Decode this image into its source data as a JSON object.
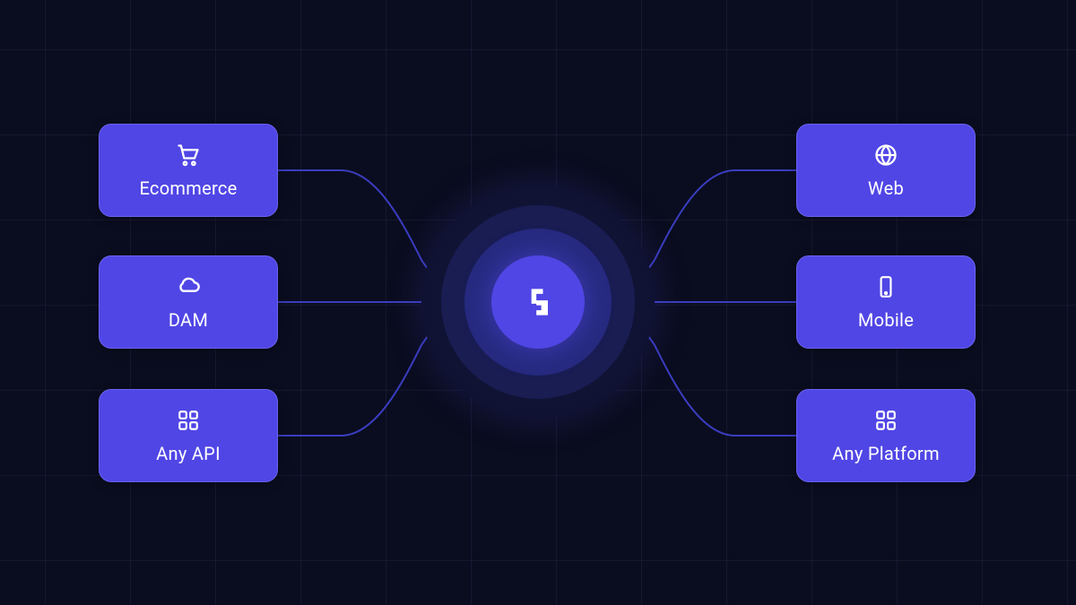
{
  "colors": {
    "background": "#0a0d1f",
    "grid_line": "rgba(80,80,150,0.15)",
    "node_fill": "#5046e5",
    "node_border": "#6a63f0",
    "connector": "#3a3dbf",
    "text": "#ffffff"
  },
  "left_nodes": [
    {
      "label": "Ecommerce",
      "icon": "cart-icon"
    },
    {
      "label": "DAM",
      "icon": "cloud-icon"
    },
    {
      "label": "Any API",
      "icon": "grid-icon"
    }
  ],
  "right_nodes": [
    {
      "label": "Web",
      "icon": "globe-icon"
    },
    {
      "label": "Mobile",
      "icon": "mobile-icon"
    },
    {
      "label": "Any Platform",
      "icon": "grid-icon"
    }
  ],
  "center": {
    "name": "hub-logo"
  }
}
